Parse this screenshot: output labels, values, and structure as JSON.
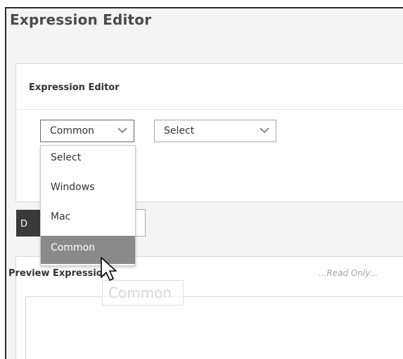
{
  "page": {
    "title": "Expression Editor"
  },
  "editor_panel": {
    "title": "Expression Editor",
    "category_select": {
      "value": "Common",
      "icon": "chevron-down-icon"
    },
    "function_select": {
      "value": "Select",
      "icon": "chevron-down-icon"
    },
    "dropdown": {
      "options": [
        "Select",
        "Windows",
        "Mac",
        "Common"
      ],
      "highlighted": "Common"
    },
    "action_button_label": "D"
  },
  "preview_panel": {
    "label": "Preview Expression",
    "readonly_label": "...Read Only..."
  },
  "drag_ghost_text": "Common"
}
